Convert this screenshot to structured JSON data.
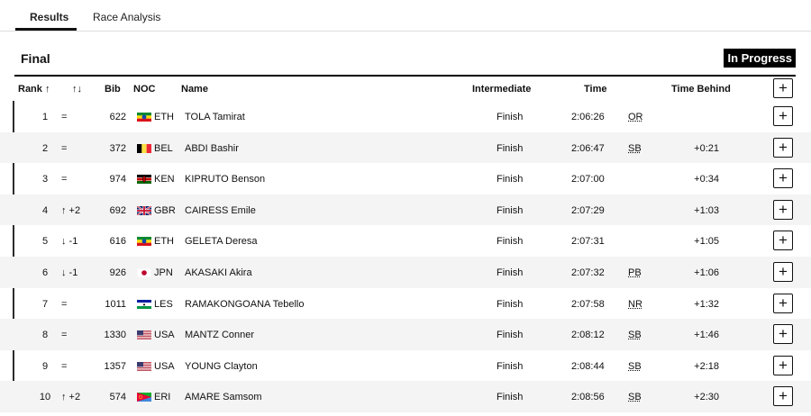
{
  "tabs": [
    {
      "label": "Results",
      "active": true
    },
    {
      "label": "Race Analysis",
      "active": false
    }
  ],
  "section_title": "Final",
  "status": "In Progress",
  "columns": {
    "rank": "Rank ↑",
    "change": "↑↓",
    "bib": "Bib",
    "noc": "NOC",
    "name": "Name",
    "intermediate": "Intermediate",
    "time": "Time",
    "time_behind": "Time Behind",
    "expand": "+"
  },
  "rows": [
    {
      "rank": "1",
      "change": "=",
      "bib": "622",
      "flag": "flag-eth",
      "noc": "ETH",
      "name": "TOLA Tamirat",
      "intermediate": "Finish",
      "time": "2:06:26",
      "record": "OR",
      "behind": ""
    },
    {
      "rank": "2",
      "change": "=",
      "bib": "372",
      "flag": "flag-bel",
      "noc": "BEL",
      "name": "ABDI Bashir",
      "intermediate": "Finish",
      "time": "2:06:47",
      "record": "SB",
      "behind": "+0:21"
    },
    {
      "rank": "3",
      "change": "=",
      "bib": "974",
      "flag": "flag-ken",
      "noc": "KEN",
      "name": "KIPRUTO Benson",
      "intermediate": "Finish",
      "time": "2:07:00",
      "record": "",
      "behind": "+0:34"
    },
    {
      "rank": "4",
      "change": "↑ +2",
      "bib": "692",
      "flag": "flag-gbr",
      "noc": "GBR",
      "name": "CAIRESS Emile",
      "intermediate": "Finish",
      "time": "2:07:29",
      "record": "",
      "behind": "+1:03"
    },
    {
      "rank": "5",
      "change": "↓ -1",
      "bib": "616",
      "flag": "flag-eth",
      "noc": "ETH",
      "name": "GELETA Deresa",
      "intermediate": "Finish",
      "time": "2:07:31",
      "record": "",
      "behind": "+1:05"
    },
    {
      "rank": "6",
      "change": "↓ -1",
      "bib": "926",
      "flag": "flag-jpn",
      "noc": "JPN",
      "name": "AKASAKI Akira",
      "intermediate": "Finish",
      "time": "2:07:32",
      "record": "PB",
      "behind": "+1:06"
    },
    {
      "rank": "7",
      "change": "=",
      "bib": "1011",
      "flag": "flag-les",
      "noc": "LES",
      "name": "RAMAKONGOANA Tebello",
      "intermediate": "Finish",
      "time": "2:07:58",
      "record": "NR",
      "behind": "+1:32"
    },
    {
      "rank": "8",
      "change": "=",
      "bib": "1330",
      "flag": "flag-usa",
      "noc": "USA",
      "name": "MANTZ Conner",
      "intermediate": "Finish",
      "time": "2:08:12",
      "record": "SB",
      "behind": "+1:46"
    },
    {
      "rank": "9",
      "change": "=",
      "bib": "1357",
      "flag": "flag-usa",
      "noc": "USA",
      "name": "YOUNG Clayton",
      "intermediate": "Finish",
      "time": "2:08:44",
      "record": "SB",
      "behind": "+2:18"
    },
    {
      "rank": "10",
      "change": "↑ +2",
      "bib": "574",
      "flag": "flag-eri",
      "noc": "ERI",
      "name": "AMARE Samsom",
      "intermediate": "Finish",
      "time": "2:08:56",
      "record": "SB",
      "behind": "+2:30"
    }
  ],
  "colors": {
    "accent": "#000000",
    "row_alt": "#f4f4f4"
  }
}
